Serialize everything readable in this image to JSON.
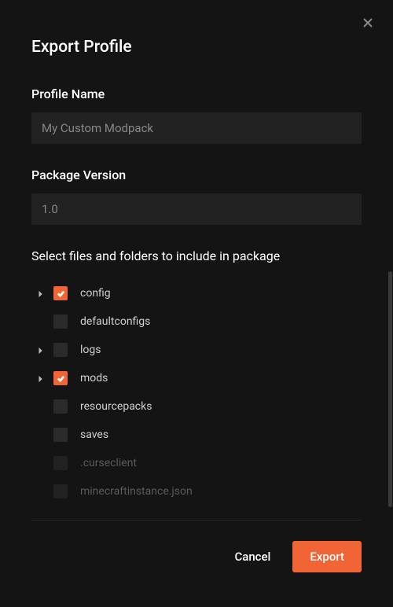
{
  "dialog": {
    "title": "Export Profile"
  },
  "profileName": {
    "label": "Profile Name",
    "value": "My Custom Modpack"
  },
  "packageVersion": {
    "label": "Package Version",
    "value": "1.0"
  },
  "filesSection": {
    "label": "Select files and folders to include in package",
    "items": [
      {
        "label": "config",
        "checked": true,
        "expandable": true,
        "disabled": false
      },
      {
        "label": "defaultconfigs",
        "checked": false,
        "expandable": false,
        "disabled": false
      },
      {
        "label": "logs",
        "checked": false,
        "expandable": true,
        "disabled": false
      },
      {
        "label": "mods",
        "checked": true,
        "expandable": true,
        "disabled": false
      },
      {
        "label": "resourcepacks",
        "checked": false,
        "expandable": false,
        "disabled": false
      },
      {
        "label": "saves",
        "checked": false,
        "expandable": false,
        "disabled": false
      },
      {
        "label": ".curseclient",
        "checked": false,
        "expandable": false,
        "disabled": true
      },
      {
        "label": "minecraftinstance.json",
        "checked": false,
        "expandable": false,
        "disabled": true
      }
    ]
  },
  "footer": {
    "cancel": "Cancel",
    "export": "Export"
  },
  "colors": {
    "accent": "#f16436",
    "background": "#141414",
    "input": "#222222"
  }
}
